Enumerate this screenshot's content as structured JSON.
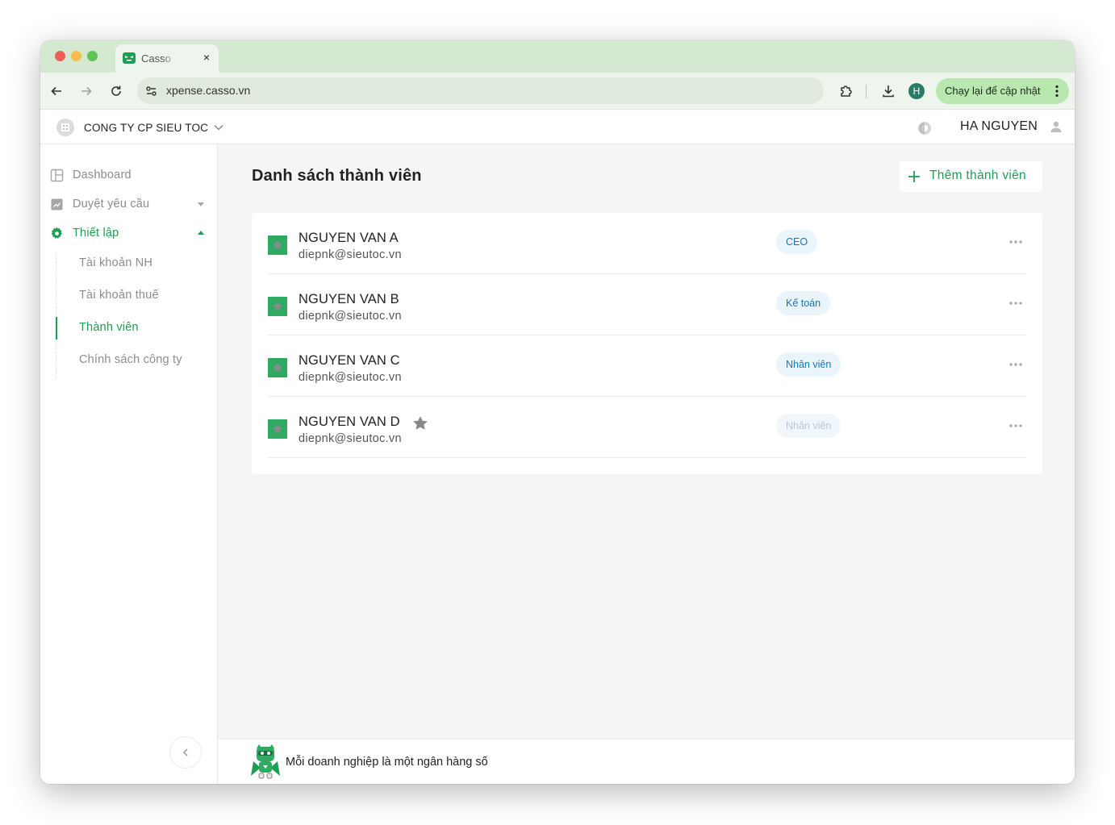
{
  "browser": {
    "tab_title": "Casso",
    "tab_close": "×",
    "url": "xpense.casso.vn",
    "profile_initial": "H",
    "update_button": "Chạy lại để cập nhật"
  },
  "header": {
    "company": "CONG TY CP SIEU TOC",
    "user_name": "HA NGUYEN"
  },
  "sidebar": {
    "items": [
      {
        "label": "Dashboard",
        "icon": "dashboard-icon"
      },
      {
        "label": "Duyệt yêu cầu",
        "icon": "approval-icon"
      },
      {
        "label": "Thiết lập",
        "icon": "gear-icon"
      }
    ],
    "sub_items": [
      {
        "label": "Tài khoản NH"
      },
      {
        "label": "Tài khoản thuế"
      },
      {
        "label": "Thành viên"
      },
      {
        "label": "Chính sách công ty"
      }
    ]
  },
  "main": {
    "title": "Danh sách thành viên",
    "add_button": "Thêm thành viên",
    "members": [
      {
        "name": "NGUYEN VAN A",
        "email": "diepnk@sieutoc.vn",
        "role": "CEO"
      },
      {
        "name": "NGUYEN VAN B",
        "email": "diepnk@sieutoc.vn",
        "role": "Kế toán"
      },
      {
        "name": "NGUYEN VAN C",
        "email": "diepnk@sieutoc.vn",
        "role": "Nhân viên"
      },
      {
        "name": "NGUYEN VAN D",
        "email": "diepnk@sieutoc.vn",
        "role": "Nhân viên"
      }
    ]
  },
  "footer": {
    "tagline": "Mỗi doanh nghiệp là một ngân hàng số"
  },
  "colors": {
    "brand_green": "#1f9d55",
    "chrome_green": "#d4e8d2",
    "badge_blue": "#1677b5"
  }
}
